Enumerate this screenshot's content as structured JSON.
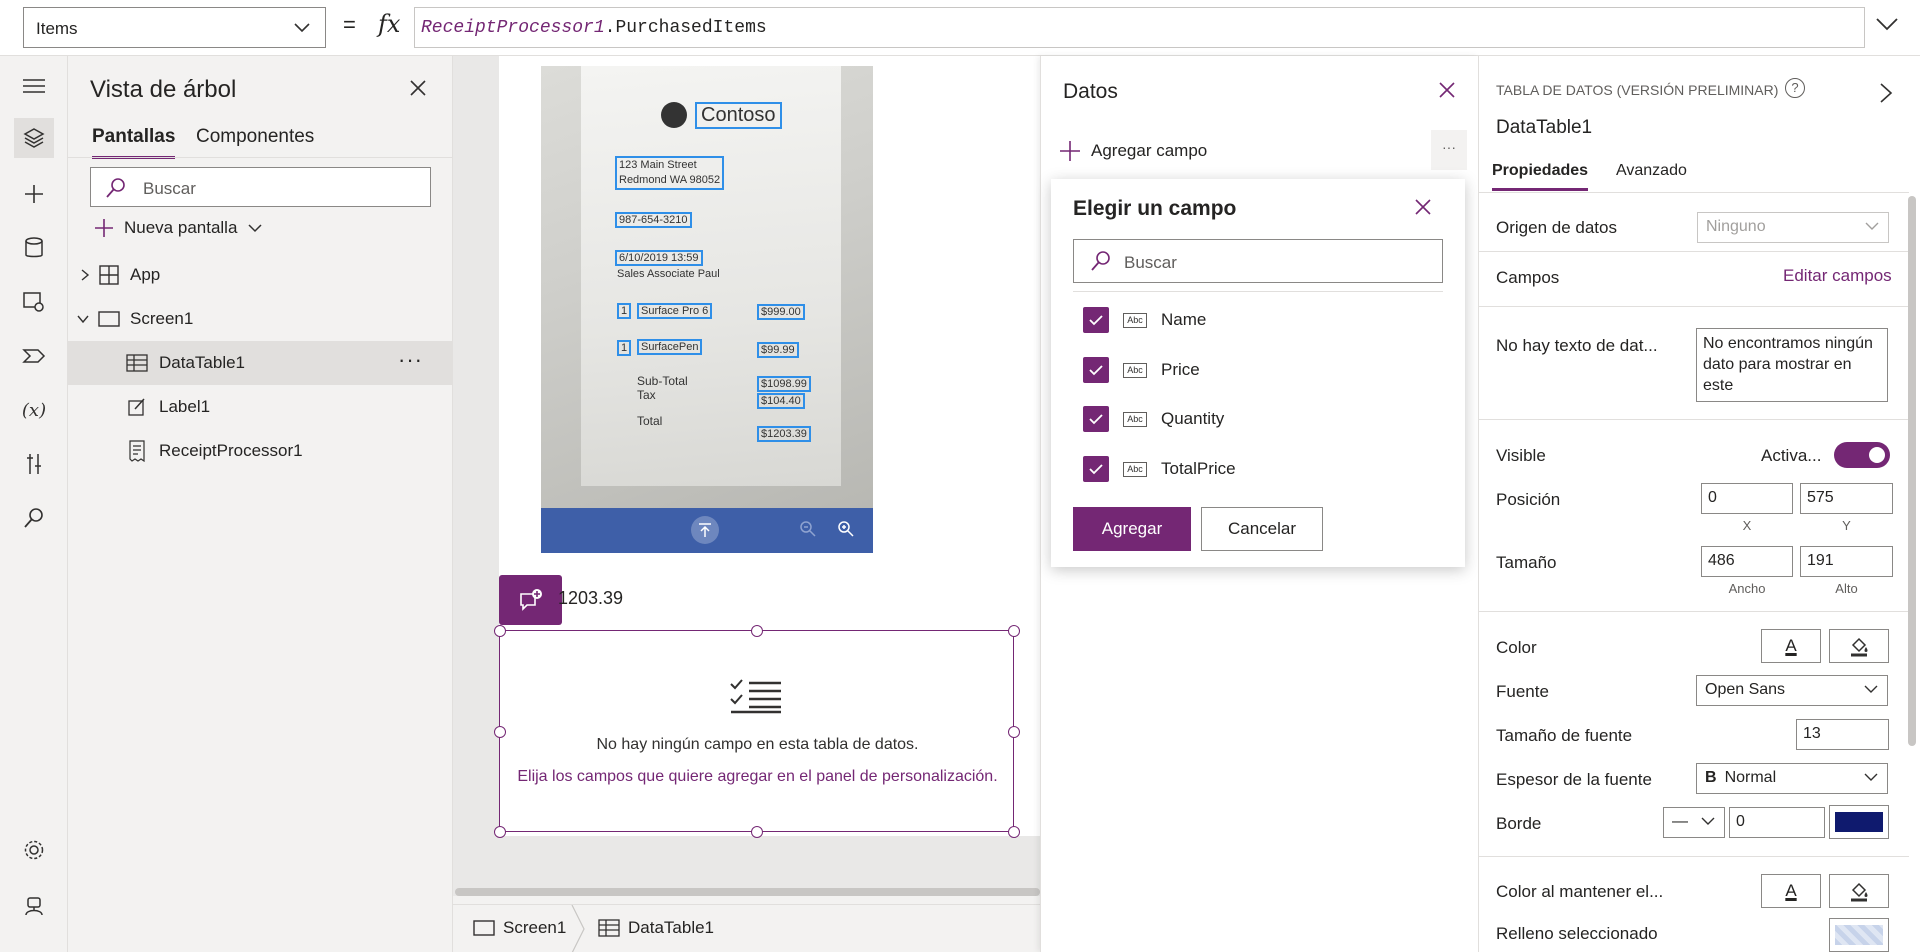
{
  "formula": {
    "property": "Items",
    "equals": "=",
    "fx": "fx",
    "control": "ReceiptProcessor1",
    "member": ".PurchasedItems"
  },
  "tree": {
    "title": "Vista de árbol",
    "tabs": [
      "Pantallas",
      "Componentes"
    ],
    "search_placeholder": "Buscar",
    "new_screen": "Nueva pantalla",
    "items": [
      "App",
      "Screen1",
      "DataTable1",
      "Label1",
      "ReceiptProcessor1"
    ],
    "more": "···"
  },
  "canvas": {
    "receipt": {
      "brand": "Contoso",
      "address1": "123 Main Street",
      "address2": "Redmond WA 98052",
      "phone": "987-654-3210",
      "date": "6/10/2019 13:59",
      "associate": "Sales Associate  Paul",
      "qty1": "1",
      "item1": "Surface Pro 6",
      "price1": "$999.00",
      "qty2": "1",
      "item2": "SurfacePen",
      "price2": "$99.99",
      "subtotal_label": "Sub-Total",
      "subtotal": "$1098.99",
      "tax_label": "Tax",
      "tax": "$104.40",
      "total_label": "Total",
      "total": "$1203.39"
    },
    "total_label": "1203.39",
    "datatable_empty": "No hay ningún campo en esta tabla de datos.",
    "datatable_hint": "Elija los campos que quiere agregar en el panel de personalización."
  },
  "breadcrumb": [
    "Screen1",
    "DataTable1"
  ],
  "datos": {
    "title": "Datos",
    "add_field": "Agregar campo",
    "more": "···"
  },
  "popup": {
    "title": "Elegir un campo",
    "search_placeholder": "Buscar",
    "field_type": "Abc",
    "fields": [
      "Name",
      "Price",
      "Quantity",
      "TotalPrice"
    ],
    "add": "Agregar",
    "cancel": "Cancelar"
  },
  "props": {
    "type_label": "TABLA DE DATOS (VERSIÓN PRELIMINAR)",
    "help": "?",
    "name": "DataTable1",
    "tabs": [
      "Propiedades",
      "Avanzado"
    ],
    "origin_label": "Origen de datos",
    "origin_value": "Ninguno",
    "fields_label": "Campos",
    "edit_fields": "Editar campos",
    "notext_label": "No hay texto de dat...",
    "notext_value": "No encontramos ningún dato para mostrar en este",
    "visible_label": "Visible",
    "visible_state": "Activa...",
    "position_label": "Posición",
    "x": "0",
    "y": "575",
    "x_label": "X",
    "y_label": "Y",
    "size_label": "Tamaño",
    "width": "486",
    "height": "191",
    "width_label": "Ancho",
    "height_label": "Alto",
    "color_label": "Color",
    "font_label": "Fuente",
    "font_value": "Open Sans",
    "font_size_label": "Tamaño de fuente",
    "font_size": "13",
    "font_weight_label": "Espesor de la fuente",
    "font_weight_value": "Normal",
    "font_weight_glyph": "B",
    "border_label": "Borde",
    "border_width": "0",
    "border_style": "—",
    "border_color": "#0f1a6e",
    "hover_color_label": "Color al mantener el...",
    "selected_fill_label": "Relleno seleccionado",
    "text_glyph": "A"
  },
  "colors": {
    "accent": "#742774",
    "receipt_box": "#2f8fe8",
    "receipt_toolbar": "#3e5fa8"
  },
  "icons": [
    "hamburger-icon",
    "tree-layers-icon",
    "plus-icon",
    "database-icon",
    "media-icon",
    "theme-icon",
    "variables-icon",
    "tools-icon",
    "search-icon",
    "settings-icon",
    "virtual-agent-icon"
  ]
}
